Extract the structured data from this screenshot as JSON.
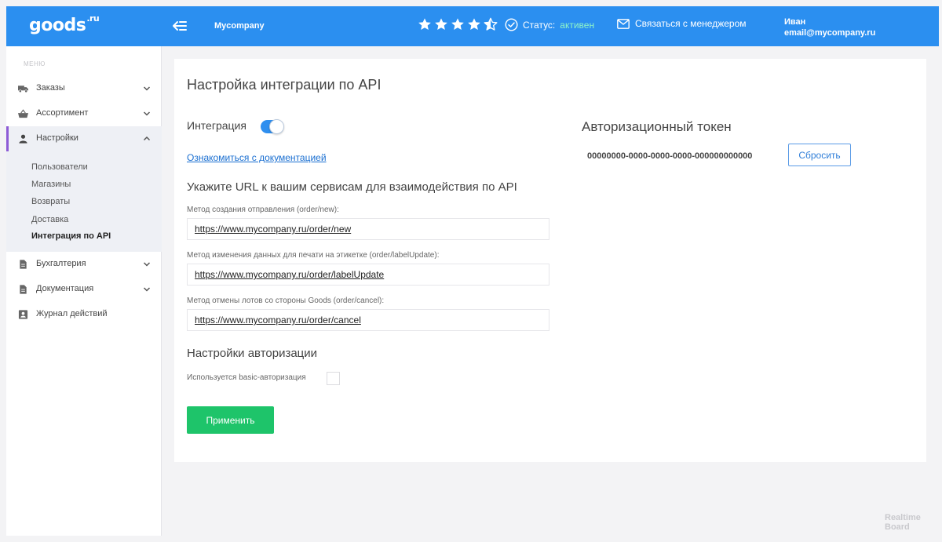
{
  "header": {
    "logo": "goods",
    "logo_suffix": ".ru",
    "company": "Mycompany",
    "rating": 4.5,
    "status_label": "Статус:",
    "status_value": "активен",
    "contact_label": "Связаться с менеджером",
    "user_name": "Иван",
    "user_email": "email@mycompany.ru"
  },
  "sidebar": {
    "caption": "МЕНЮ",
    "items": [
      {
        "label": "Заказы",
        "icon": "truck-icon"
      },
      {
        "label": "Ассортимент",
        "icon": "basket-icon"
      },
      {
        "label": "Настройки",
        "icon": "person-icon"
      },
      {
        "label": "Бухгалтерия",
        "icon": "document-icon"
      },
      {
        "label": "Документация",
        "icon": "document-icon"
      },
      {
        "label": "Журнал действий",
        "icon": "account-icon"
      }
    ],
    "sub_items": [
      "Пользователи",
      "Магазины",
      "Возвраты",
      "Доставка",
      "Интеграция по API"
    ]
  },
  "main": {
    "title": "Настройка интеграции по API",
    "integration_label": "Интеграция",
    "integration_enabled": true,
    "doc_link": "Ознакомиться с документацией",
    "urls_title": "Укажите URL к вашим сервисам для взаимодействия по API",
    "fields": [
      {
        "label": "Метод создания отправления (order/new):",
        "value": "https://www.mycompany.ru/order/new"
      },
      {
        "label": "Метод изменения данных для печати на этикетке (order/labelUpdate):",
        "value": "https://www.mycompany.ru/order/labelUpdate"
      },
      {
        "label": "Метод отмены лотов со стороны Goods (order/cancel):",
        "value": "https://www.mycompany.ru/order/cancel"
      }
    ],
    "auth_title": "Настройки авторизации",
    "basic_auth_label": "Используется basic-авторизация",
    "basic_auth_checked": false,
    "apply_label": "Применить",
    "token_title": "Авторизационный токен",
    "token_value": "00000000-0000-0000-0000-000000000000",
    "reset_label": "Сбросить"
  },
  "watermark": {
    "line1": "Realtime",
    "line2": "Board"
  },
  "colors": {
    "header": "#2b8ff0",
    "accent": "#8d5bd6",
    "apply": "#1ec46a",
    "status": "#8ff5c8"
  }
}
